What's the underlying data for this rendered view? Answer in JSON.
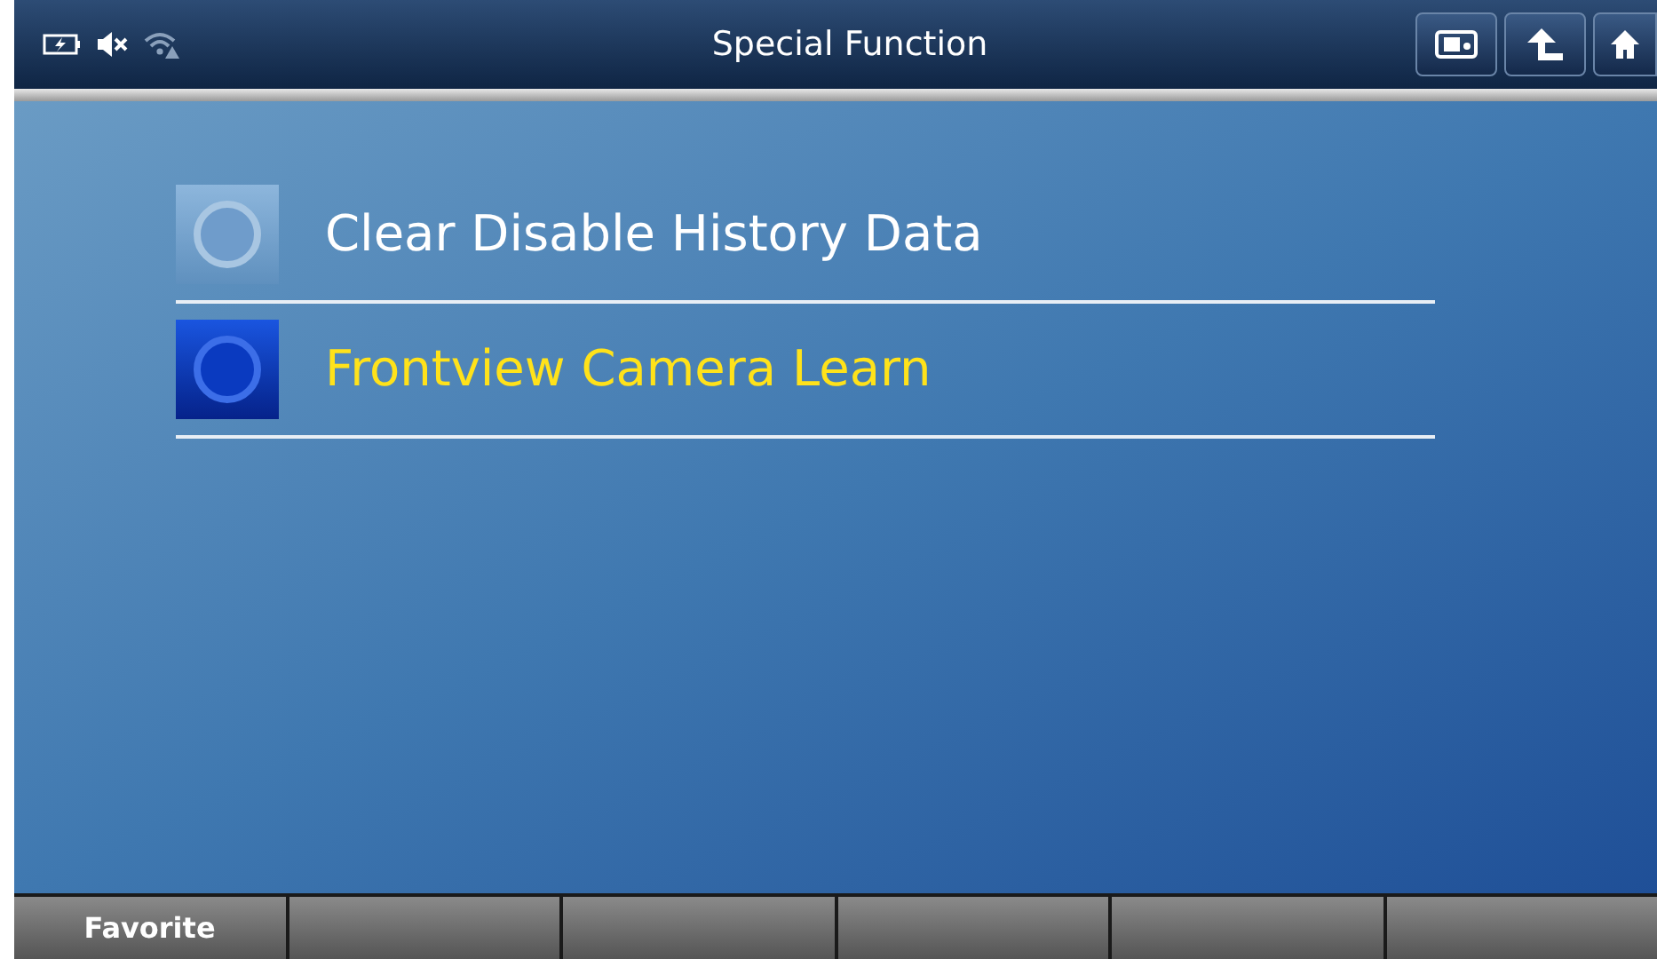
{
  "status_bar": {
    "title": "Special Function"
  },
  "menu_items": [
    {
      "label": "Clear Disable History Data",
      "selected": false
    },
    {
      "label": "Frontview Camera Learn",
      "selected": true
    }
  ],
  "function_keys": [
    {
      "label": "Favorite"
    }
  ]
}
